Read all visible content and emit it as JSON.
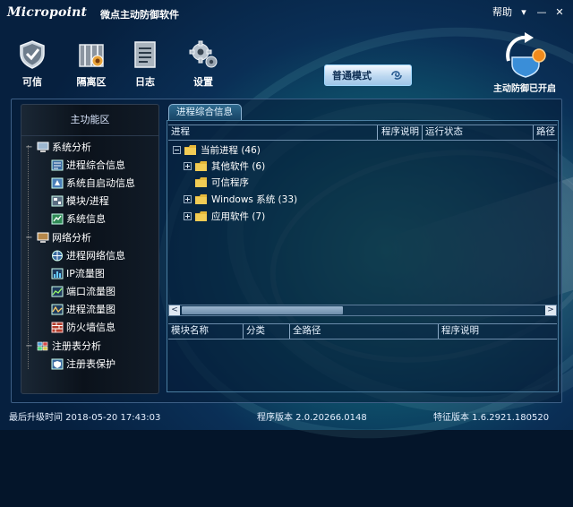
{
  "app": {
    "logo": "Micropoint",
    "title": "微点主动防御软件",
    "help": "帮助"
  },
  "toolbar": {
    "items": [
      {
        "label": "可信",
        "icon": "shield-check-icon"
      },
      {
        "label": "隔离区",
        "icon": "quarantine-box-icon"
      },
      {
        "label": "日志",
        "icon": "log-document-icon"
      },
      {
        "label": "设置",
        "icon": "gear-icon"
      }
    ],
    "mode_button": "普通模式",
    "active_status": "主动防御已开启"
  },
  "sidebar": {
    "title": "主功能区",
    "groups": [
      {
        "label": "系统分析",
        "items": [
          "进程综合信息",
          "系统自启动信息",
          "模块/进程",
          "系统信息"
        ]
      },
      {
        "label": "网络分析",
        "items": [
          "进程网络信息",
          "IP流量图",
          "端口流量图",
          "进程流量图",
          "防火墙信息"
        ]
      },
      {
        "label": "注册表分析",
        "items": [
          "注册表保护"
        ]
      }
    ]
  },
  "content": {
    "tab": "进程综合信息",
    "columns": [
      "进程",
      "程序说明",
      "运行状态",
      "路径"
    ],
    "tree": {
      "root": "当前进程 (46)",
      "children": [
        "其他软件 (6)",
        "可信程序",
        "Windows 系统 (33)",
        "应用软件 (7)"
      ]
    },
    "columns2": [
      "模块名称",
      "分类",
      "全路径",
      "程序说明"
    ]
  },
  "status": {
    "last_update": "最后升级时间 2018-05-20 17:43:03",
    "program_version": "程序版本 2.0.20266.0148",
    "signature_version": "特征版本 1.6.2921.180520"
  },
  "colors": {
    "accent": "#1d8a86",
    "panel_border": "#4a7da0",
    "mode_button": "#bcd7f0",
    "folder": "#e6b83a"
  }
}
